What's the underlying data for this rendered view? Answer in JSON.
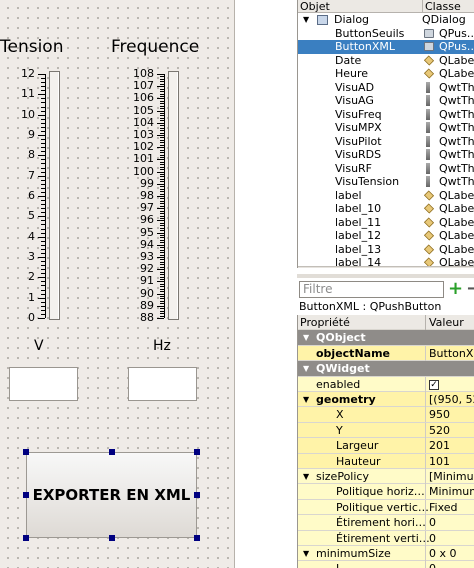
{
  "form": {
    "tension_label": "Tension",
    "frequence_label": "Frequence",
    "tension_ticks": [
      "12",
      "11",
      "10",
      "9",
      "8",
      "7",
      "6",
      "5",
      "4",
      "3",
      "2",
      "1",
      "0"
    ],
    "freq_ticks": [
      "108",
      "107",
      "106",
      "105",
      "104",
      "103",
      "102",
      "101",
      "100",
      "99",
      "98",
      "97",
      "96",
      "95",
      "94",
      "93",
      "92",
      "91",
      "90",
      "89",
      "88"
    ],
    "unit_v": "V",
    "unit_hz": "Hz",
    "export_button": "EXPORTER EN XML"
  },
  "object_inspector": {
    "col_object": "Objet",
    "col_class": "Classe",
    "root": {
      "name": "Dialog",
      "class": "QDialog"
    },
    "rows": [
      {
        "name": "ButtonSeuils",
        "class": "QPus…",
        "icon": "push-button-icon",
        "selected": false
      },
      {
        "name": "ButtonXML",
        "class": "QPus…",
        "icon": "push-button-icon",
        "selected": true
      },
      {
        "name": "Date",
        "class": "QLabe",
        "icon": "label-icon",
        "selected": false
      },
      {
        "name": "Heure",
        "class": "QLabe",
        "icon": "label-icon",
        "selected": false
      },
      {
        "name": "VisuAD",
        "class": "QwtThe",
        "icon": "thermo-icon",
        "selected": false
      },
      {
        "name": "VisuAG",
        "class": "QwtThe",
        "icon": "thermo-icon",
        "selected": false
      },
      {
        "name": "VisuFreq",
        "class": "QwtThe",
        "icon": "thermo-icon",
        "selected": false
      },
      {
        "name": "VisuMPX",
        "class": "QwtThe",
        "icon": "thermo-icon",
        "selected": false
      },
      {
        "name": "VisuPilot",
        "class": "QwtThe",
        "icon": "thermo-icon",
        "selected": false
      },
      {
        "name": "VisuRDS",
        "class": "QwtThe",
        "icon": "thermo-icon",
        "selected": false
      },
      {
        "name": "VisuRF",
        "class": "QwtThe",
        "icon": "thermo-icon",
        "selected": false
      },
      {
        "name": "VisuTension",
        "class": "QwtThe",
        "icon": "thermo-icon",
        "selected": false
      },
      {
        "name": "label",
        "class": "QLabe",
        "icon": "label-icon",
        "selected": false
      },
      {
        "name": "label_10",
        "class": "QLabe",
        "icon": "label-icon",
        "selected": false
      },
      {
        "name": "label_11",
        "class": "QLabe",
        "icon": "label-icon",
        "selected": false
      },
      {
        "name": "label_12",
        "class": "QLabe",
        "icon": "label-icon",
        "selected": false
      },
      {
        "name": "label_13",
        "class": "QLabe",
        "icon": "label-icon",
        "selected": false
      },
      {
        "name": "label_14",
        "class": "QLabe",
        "icon": "label-icon",
        "selected": false
      }
    ],
    "selection_color": "#3a7fc1"
  },
  "property_editor": {
    "filter_placeholder": "Filtre",
    "add_symbol": "+",
    "remove_symbol": "−",
    "title": "ButtonXML : QPushButton",
    "col_property": "Propriété",
    "col_value": "Valeur",
    "rows": [
      {
        "name": "QObject",
        "value": "",
        "kind": "grp",
        "indent": 0
      },
      {
        "name": "objectName",
        "value": "ButtonX",
        "kind": "y2",
        "indent": 1,
        "bold": true
      },
      {
        "name": "QWidget",
        "value": "",
        "kind": "grp",
        "indent": 0
      },
      {
        "name": "enabled",
        "value": "✓",
        "kind": "y1",
        "indent": 1,
        "check": true
      },
      {
        "name": "geometry",
        "value": "[(950, 52",
        "kind": "y2",
        "indent": 1,
        "bold": true,
        "expand": true
      },
      {
        "name": "X",
        "value": "950",
        "kind": "y2",
        "indent": 2
      },
      {
        "name": "Y",
        "value": "520",
        "kind": "y2",
        "indent": 2
      },
      {
        "name": "Largeur",
        "value": "201",
        "kind": "y2",
        "indent": 2
      },
      {
        "name": "Hauteur",
        "value": "101",
        "kind": "y2",
        "indent": 2
      },
      {
        "name": "sizePolicy",
        "value": "[Minimum",
        "kind": "y1",
        "indent": 1,
        "expand": true
      },
      {
        "name": "Politique horiz…",
        "value": "Minimum",
        "kind": "y1",
        "indent": 2
      },
      {
        "name": "Politique vertic…",
        "value": "Fixed",
        "kind": "y1",
        "indent": 2
      },
      {
        "name": "Étirement hori…",
        "value": "0",
        "kind": "y1",
        "indent": 2
      },
      {
        "name": "Étirement verti…",
        "value": "0",
        "kind": "y1",
        "indent": 2
      },
      {
        "name": "minimumSize",
        "value": "0 x 0",
        "kind": "y1",
        "indent": 1,
        "expand": true
      },
      {
        "name": "L…",
        "value": "0",
        "kind": "y1",
        "indent": 2
      }
    ],
    "group_color": "#8f8c89"
  }
}
